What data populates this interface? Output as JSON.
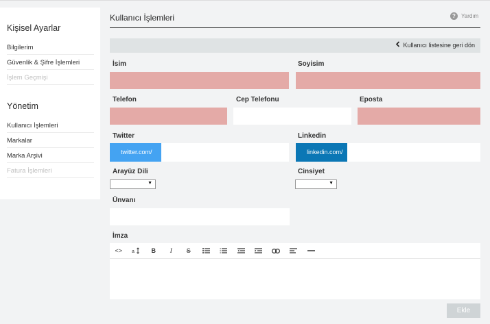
{
  "sidebar": {
    "section1_title": "Kişisel Ayarlar",
    "section1_items": [
      {
        "label": "Bilgilerim",
        "disabled": false
      },
      {
        "label": "Güvenlik & Şifre İşlemleri",
        "disabled": false
      },
      {
        "label": "İşlem Geçmişi",
        "disabled": true
      }
    ],
    "section2_title": "Yönetim",
    "section2_items": [
      {
        "label": "Kullanıcı İşlemleri",
        "disabled": false
      },
      {
        "label": "Markalar",
        "disabled": false
      },
      {
        "label": "Marka Arşivi",
        "disabled": false
      },
      {
        "label": "Fatura İşlemleri",
        "disabled": true
      }
    ]
  },
  "header": {
    "title": "Kullanıcı İşlemleri",
    "help_label": "Yardım",
    "help_icon": "question-icon"
  },
  "back_bar": {
    "label": "Kullanıcı listesine geri dön",
    "icon": "chevron-left-icon"
  },
  "form": {
    "isim": {
      "label": "İsim",
      "value": ""
    },
    "soyisim": {
      "label": "Soyisim",
      "value": ""
    },
    "telefon": {
      "label": "Telefon",
      "value": ""
    },
    "cep_telefonu": {
      "label": "Cep Telefonu",
      "value": ""
    },
    "eposta": {
      "label": "Eposta",
      "value": ""
    },
    "twitter": {
      "label": "Twitter",
      "prefix": "twitter.com/",
      "value": ""
    },
    "linkedin": {
      "label": "Linkedin",
      "prefix": "linkedin.com/",
      "value": ""
    },
    "arayuz_dili": {
      "label": "Arayüz Dili",
      "selected": ""
    },
    "cinsiyet": {
      "label": "Cinsiyet",
      "selected": ""
    },
    "unvani": {
      "label": "Ünvanı",
      "value": ""
    },
    "imza": {
      "label": "İmza"
    }
  },
  "toolbar_buttons": [
    "code-view-icon",
    "font-size-icon",
    "bold-icon",
    "italic-icon",
    "strikethrough-icon",
    "unordered-list-icon",
    "ordered-list-icon",
    "outdent-icon",
    "indent-icon",
    "link-icon",
    "align-left-icon",
    "horizontal-rule-icon"
  ],
  "toolbar_text": {
    "code": "<>",
    "bold": "B",
    "italic": "I",
    "strike": "S"
  },
  "submit_label": "Ekle",
  "colors": {
    "error_field": "#e4aaa7",
    "twitter": "#44a3f2",
    "linkedin": "#0b77b5",
    "submit_disabled": "#cfd4d6"
  }
}
